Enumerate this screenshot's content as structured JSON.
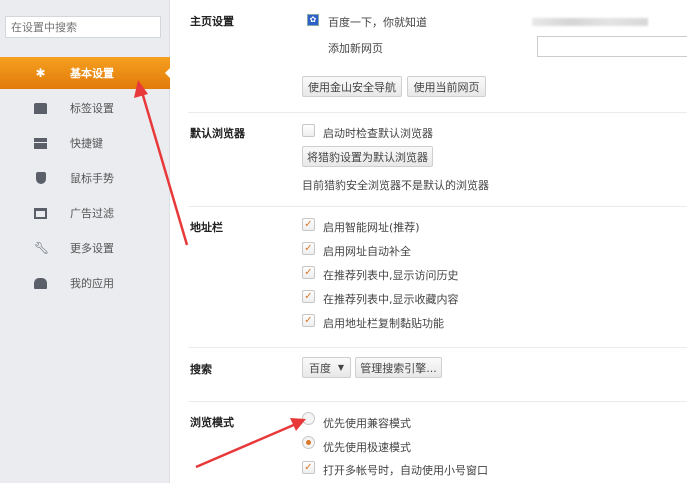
{
  "sidebar": {
    "search_placeholder": "在设置中搜索",
    "items": [
      {
        "label": "基本设置",
        "icon": "gear-icon",
        "active": true
      },
      {
        "label": "标签设置",
        "icon": "tab-icon"
      },
      {
        "label": "快捷键",
        "icon": "keyboard-icon"
      },
      {
        "label": "鼠标手势",
        "icon": "mouse-icon"
      },
      {
        "label": "广告过滤",
        "icon": "window-icon"
      },
      {
        "label": "更多设置",
        "icon": "wrench-icon"
      },
      {
        "label": "我的应用",
        "icon": "puzzle-icon"
      }
    ]
  },
  "homepage": {
    "title": "主页设置",
    "page_name": "百度一下，你就知道",
    "add_label": "添加新网页",
    "btn_nav": "使用金山安全导航",
    "btn_current": "使用当前网页"
  },
  "default_browser": {
    "title": "默认浏览器",
    "check_label": "启动时检查默认浏览器",
    "checked": false,
    "set_button": "将猎豹设置为默认浏览器",
    "status": "目前猎豹安全浏览器不是默认的浏览器"
  },
  "address_bar": {
    "title": "地址栏",
    "options": [
      {
        "label": "启用智能网址(推荐)",
        "checked": true
      },
      {
        "label": "启用网址自动补全",
        "checked": true
      },
      {
        "label": "在推荐列表中,显示访问历史",
        "checked": true
      },
      {
        "label": "在推荐列表中,显示收藏内容",
        "checked": true
      },
      {
        "label": "启用地址栏复制黏贴功能",
        "checked": true
      }
    ]
  },
  "search": {
    "title": "搜索",
    "engine": "百度",
    "manage_button": "管理搜索引擎..."
  },
  "browse_mode": {
    "title": "浏览模式",
    "options": [
      {
        "label": "优先使用兼容模式",
        "selected": false
      },
      {
        "label": "优先使用极速模式",
        "selected": true
      }
    ],
    "multi_account": {
      "label": "打开多帐号时，自动使用小号窗口",
      "checked": true
    }
  },
  "colors": {
    "accent": "#f0921a",
    "arrow": "#e8393a"
  }
}
